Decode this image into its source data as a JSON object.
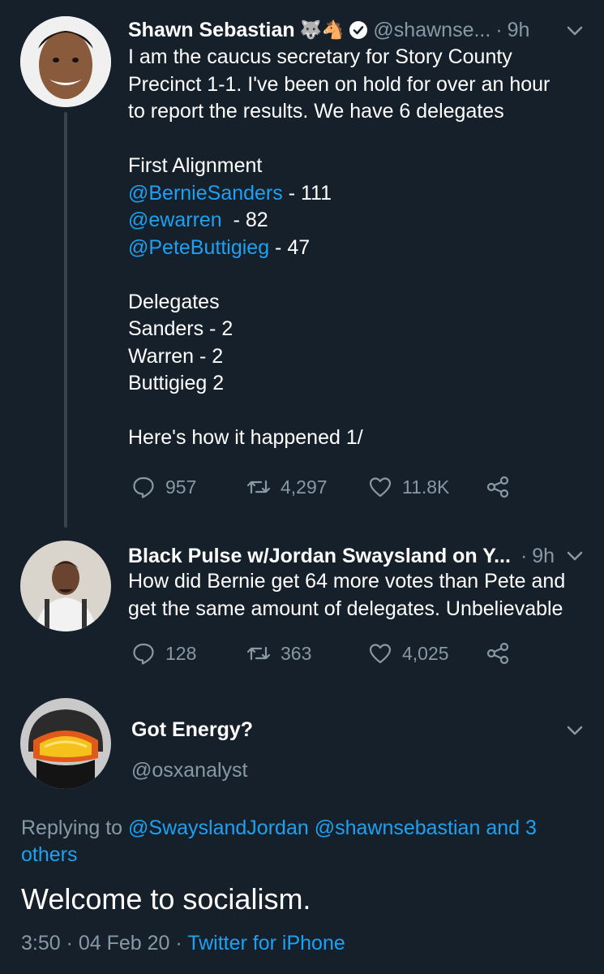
{
  "tweets": [
    {
      "name": "Shawn Sebastian",
      "emoji": "🐺🐴",
      "handle": "@shawnse...",
      "dot": "·",
      "time": "9h",
      "text_lines": [
        {
          "parts": [
            {
              "t": "I am the caucus secretary for Story County"
            }
          ]
        },
        {
          "parts": [
            {
              "t": "Precinct 1-1. I've been on hold for over an hour"
            }
          ]
        },
        {
          "parts": [
            {
              "t": "to report the results. We have 6 delegates"
            }
          ]
        },
        {
          "parts": [
            {
              "t": ""
            }
          ]
        },
        {
          "parts": [
            {
              "t": "First Alignment"
            }
          ]
        },
        {
          "parts": [
            {
              "t": "@BernieSanders",
              "m": true
            },
            {
              "t": " - 111"
            }
          ]
        },
        {
          "parts": [
            {
              "t": "@ewarren",
              "m": true
            },
            {
              "t": "  - 82"
            }
          ]
        },
        {
          "parts": [
            {
              "t": "@PeteButtigieg",
              "m": true
            },
            {
              "t": " - 47"
            }
          ]
        },
        {
          "parts": [
            {
              "t": ""
            }
          ]
        },
        {
          "parts": [
            {
              "t": "Delegates"
            }
          ]
        },
        {
          "parts": [
            {
              "t": "Sanders - 2"
            }
          ]
        },
        {
          "parts": [
            {
              "t": "Warren - 2"
            }
          ]
        },
        {
          "parts": [
            {
              "t": "Buttigieg 2"
            }
          ]
        },
        {
          "parts": [
            {
              "t": ""
            }
          ]
        },
        {
          "parts": [
            {
              "t": "Here's how it happened 1/"
            }
          ]
        }
      ],
      "replies": "957",
      "retweets": "4,297",
      "likes": "11.8K"
    },
    {
      "name": "Black Pulse w/Jordan Swaysland on Y...",
      "dot": "·",
      "time": "9h",
      "text_lines": [
        {
          "parts": [
            {
              "t": "How did Bernie get 64 more votes than Pete and"
            }
          ]
        },
        {
          "parts": [
            {
              "t": "get the same amount of delegates. Unbelievable"
            }
          ]
        }
      ],
      "replies": "128",
      "retweets": "363",
      "likes": "4,025"
    }
  ],
  "focus": {
    "name": "Got Energy?",
    "handle": "@osxanalyst",
    "replying_prefix": "Replying to ",
    "replying_mention1": "@SwayslandJordan",
    "replying_mention2": "@shawnsebastian",
    "replying_rest": "and 3",
    "replying_rest2": "others",
    "text": "Welcome to socialism.",
    "time": "3:50 · 04 Feb 20 · ",
    "source": "Twitter for iPhone"
  },
  "colors": {
    "background": "#15202b",
    "accent": "#1da1f2",
    "muted": "#8899a6"
  },
  "icons": [
    "reply-icon",
    "retweet-icon",
    "like-icon",
    "share-icon",
    "verified-icon",
    "chevron-down-icon"
  ]
}
